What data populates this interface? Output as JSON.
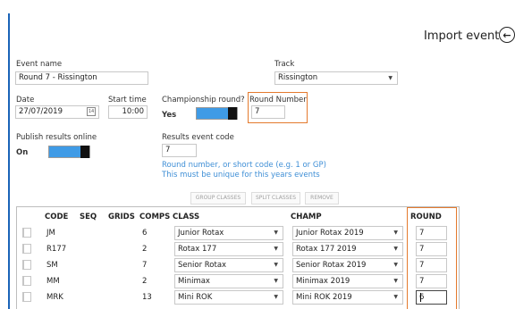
{
  "page": {
    "title": "Import event"
  },
  "form": {
    "event_name_label": "Event name",
    "event_name_value": "Round 7 - Rissington",
    "track_label": "Track",
    "track_value": "Rissington",
    "date_label": "Date",
    "date_value": "27/07/2019",
    "date_icon_text": "14",
    "start_time_label": "Start time",
    "start_time_value": "10:00",
    "championship_label": "Championship round?",
    "championship_state": "Yes",
    "round_number_label": "Round Number",
    "round_number_value": "7",
    "publish_label": "Publish results online",
    "publish_state": "On",
    "results_code_label": "Results event code",
    "results_code_value": "7",
    "hint_line1": "Round number, or short code (e.g. 1 or GP)",
    "hint_line2": "This must be unique for this years events"
  },
  "toolbar": {
    "group_classes": "GROUP CLASSES",
    "split_classes": "SPLIT CLASSES",
    "remove": "REMOVE"
  },
  "table": {
    "headers": {
      "code": "CODE",
      "seq": "SEQ",
      "grids": "GRIDS",
      "comps": "COMPS",
      "class": "CLASS",
      "champ": "CHAMP",
      "round": "ROUND"
    },
    "rows": [
      {
        "code": "JM",
        "seq": "",
        "grids": "",
        "comps": "6",
        "class": "Junior Rotax",
        "champ": "Junior Rotax 2019",
        "round": "7"
      },
      {
        "code": "R177",
        "seq": "",
        "grids": "",
        "comps": "2",
        "class": "Rotax 177",
        "champ": "Rotax 177 2019",
        "round": "7"
      },
      {
        "code": "SM",
        "seq": "",
        "grids": "",
        "comps": "7",
        "class": "Senior Rotax",
        "champ": "Senior Rotax 2019",
        "round": "7"
      },
      {
        "code": "MM",
        "seq": "",
        "grids": "",
        "comps": "2",
        "class": "Minimax",
        "champ": "Minimax 2019",
        "round": "7"
      },
      {
        "code": "MRK",
        "seq": "",
        "grids": "",
        "comps": "13",
        "class": "Mini ROK",
        "champ": "Mini ROK 2019",
        "round": "6"
      }
    ]
  },
  "colors": {
    "accent": "#3f9be6",
    "highlight": "#e47a2e",
    "hint": "#3f8fd6",
    "left_bar": "#1a63b8"
  },
  "icons": {
    "back": "arrow-left-circle-icon",
    "calendar": "calendar-icon",
    "dropdown": "chevron-down-icon"
  }
}
